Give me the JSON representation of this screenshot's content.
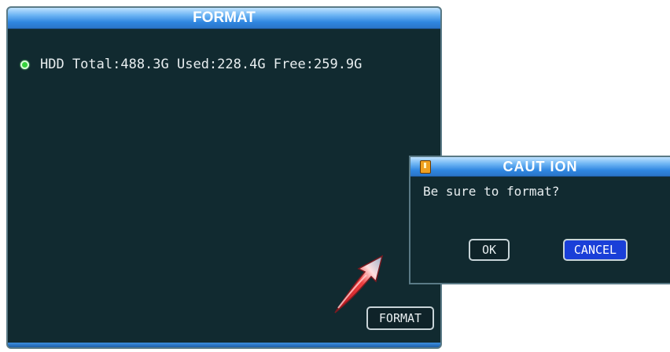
{
  "format_window": {
    "title": "FORMAT",
    "hdd_info": "HDD Total:488.3G Used:228.4G Free:259.9G",
    "format_button_label": "FORMAT"
  },
  "caution_dialog": {
    "title": "CAUT ION",
    "message": "Be sure to format?",
    "ok_label": "OK",
    "cancel_label": "CANCEL"
  },
  "colors": {
    "background": "#112a30",
    "titlebar": "#2f86e0",
    "status_dot": "#35d43c",
    "selected_button": "#1a3fd8",
    "arrow": "#d0202a"
  },
  "icons": {
    "status": "status-dot-icon",
    "warning": "warning-icon",
    "pointer": "pointer-arrow-icon"
  }
}
